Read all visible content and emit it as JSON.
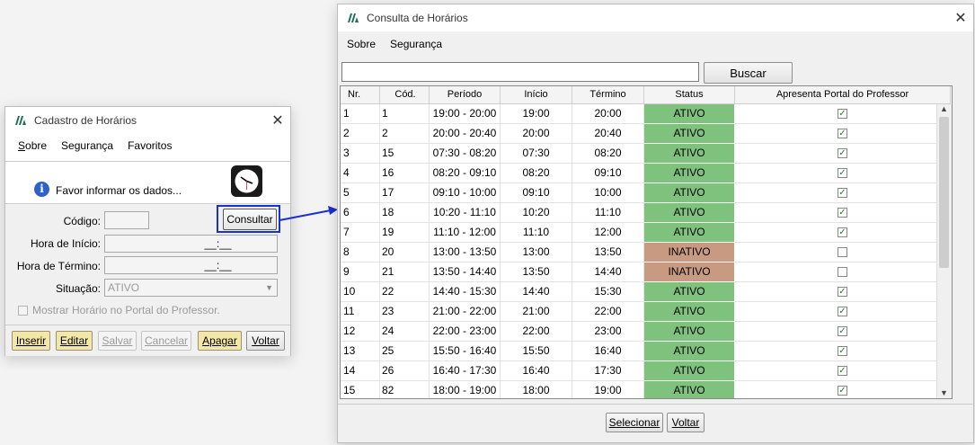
{
  "cadastro": {
    "title": "Cadastro de Horários",
    "menu": [
      {
        "pre": "S",
        "rest": "obre"
      },
      {
        "pre": "",
        "rest": "Segurança"
      },
      {
        "pre": "",
        "rest": "Favoritos"
      }
    ],
    "info_text": "Favor informar os dados...",
    "labels": {
      "codigo": "Código:",
      "hora_inicio": "Hora de Início:",
      "hora_termino": "Hora de Término:",
      "situacao": "Situação:"
    },
    "consultar_label": "Consultar",
    "hora_inicio_value": "__:__",
    "hora_termino_value": "__:__",
    "situacao_value": "ATIVO",
    "checkbox_label": "Mostrar Horário no Portal do Professor.",
    "buttons": {
      "inserir": "Inserir",
      "editar": "Editar",
      "salvar": "Salvar",
      "cancelar": "Cancelar",
      "apagar": "Apagar",
      "voltar": "Voltar"
    }
  },
  "consulta": {
    "title": "Consulta de Horários",
    "menu": [
      "Sobre",
      "Segurança"
    ],
    "search_value": "",
    "buscar_label": "Buscar",
    "columns": [
      "Nr.",
      "Cód.",
      "Período",
      "Início",
      "Término",
      "Status",
      "Apresenta Portal do Professor"
    ],
    "rows": [
      {
        "nr": "1",
        "cod": "1",
        "periodo": "19:00 - 20:00",
        "inicio": "19:00",
        "termino": "20:00",
        "status": "ATIVO",
        "portal": true
      },
      {
        "nr": "2",
        "cod": "2",
        "periodo": "20:00 - 20:40",
        "inicio": "20:00",
        "termino": "20:40",
        "status": "ATIVO",
        "portal": true
      },
      {
        "nr": "3",
        "cod": "15",
        "periodo": "07:30 - 08:20",
        "inicio": "07:30",
        "termino": "08:20",
        "status": "ATIVO",
        "portal": true
      },
      {
        "nr": "4",
        "cod": "16",
        "periodo": "08:20 - 09:10",
        "inicio": "08:20",
        "termino": "09:10",
        "status": "ATIVO",
        "portal": true
      },
      {
        "nr": "5",
        "cod": "17",
        "periodo": "09:10 - 10:00",
        "inicio": "09:10",
        "termino": "10:00",
        "status": "ATIVO",
        "portal": true
      },
      {
        "nr": "6",
        "cod": "18",
        "periodo": "10:20 - 11:10",
        "inicio": "10:20",
        "termino": "11:10",
        "status": "ATIVO",
        "portal": true
      },
      {
        "nr": "7",
        "cod": "19",
        "periodo": "11:10 - 12:00",
        "inicio": "11:10",
        "termino": "12:00",
        "status": "ATIVO",
        "portal": true
      },
      {
        "nr": "8",
        "cod": "20",
        "periodo": "13:00 - 13:50",
        "inicio": "13:00",
        "termino": "13:50",
        "status": "INATIVO",
        "portal": false
      },
      {
        "nr": "9",
        "cod": "21",
        "periodo": "13:50 - 14:40",
        "inicio": "13:50",
        "termino": "14:40",
        "status": "INATIVO",
        "portal": false
      },
      {
        "nr": "10",
        "cod": "22",
        "periodo": "14:40 - 15:30",
        "inicio": "14:40",
        "termino": "15:30",
        "status": "ATIVO",
        "portal": true
      },
      {
        "nr": "11",
        "cod": "23",
        "periodo": "21:00 - 22:00",
        "inicio": "21:00",
        "termino": "22:00",
        "status": "ATIVO",
        "portal": true
      },
      {
        "nr": "12",
        "cod": "24",
        "periodo": "22:00 - 23:00",
        "inicio": "22:00",
        "termino": "23:00",
        "status": "ATIVO",
        "portal": true
      },
      {
        "nr": "13",
        "cod": "25",
        "periodo": "15:50 - 16:40",
        "inicio": "15:50",
        "termino": "16:40",
        "status": "ATIVO",
        "portal": true
      },
      {
        "nr": "14",
        "cod": "26",
        "periodo": "16:40 - 17:30",
        "inicio": "16:40",
        "termino": "17:30",
        "status": "ATIVO",
        "portal": true
      },
      {
        "nr": "15",
        "cod": "82",
        "periodo": "18:00 - 19:00",
        "inicio": "18:00",
        "termino": "19:00",
        "status": "ATIVO",
        "portal": true
      }
    ],
    "selecionar_label": "Selecionar",
    "voltar_label": "Voltar"
  },
  "colors": {
    "ativo": "#7ec27e",
    "inativo": "#c89a82",
    "highlight": "#1a2fd6",
    "button_yellow": "#f2e7a6"
  }
}
